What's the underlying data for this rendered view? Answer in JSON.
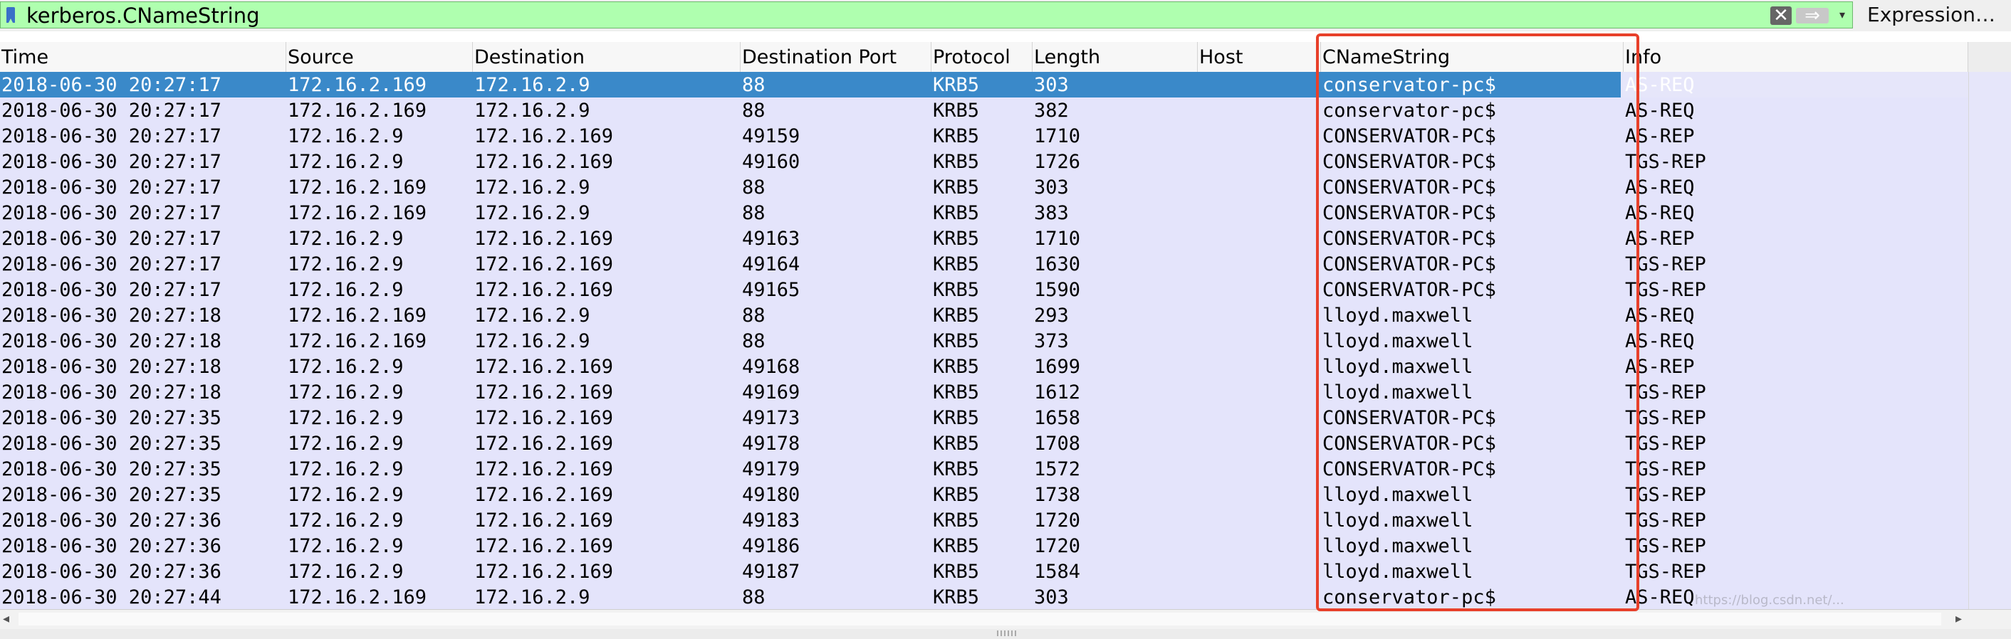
{
  "filter": {
    "value": "kerberos.CNameString",
    "expression_label": "Expression…",
    "clear_glyph": "✕",
    "apply_glyph": "⇒",
    "dropdown_glyph": "▾"
  },
  "columns": [
    "Time",
    "Source",
    "Destination",
    "Destination Port",
    "Protocol",
    "Length",
    "Host",
    "CNameString",
    "Info"
  ],
  "rows": [
    [
      "2018-06-30 20:27:17",
      "172.16.2.169",
      "172.16.2.9",
      "88",
      "KRB5",
      "303",
      "",
      "conservator-pc$",
      "AS-REQ"
    ],
    [
      "2018-06-30 20:27:17",
      "172.16.2.169",
      "172.16.2.9",
      "88",
      "KRB5",
      "382",
      "",
      "conservator-pc$",
      "AS-REQ"
    ],
    [
      "2018-06-30 20:27:17",
      "172.16.2.9",
      "172.16.2.169",
      "49159",
      "KRB5",
      "1710",
      "",
      "CONSERVATOR-PC$",
      "AS-REP"
    ],
    [
      "2018-06-30 20:27:17",
      "172.16.2.9",
      "172.16.2.169",
      "49160",
      "KRB5",
      "1726",
      "",
      "CONSERVATOR-PC$",
      "TGS-REP"
    ],
    [
      "2018-06-30 20:27:17",
      "172.16.2.169",
      "172.16.2.9",
      "88",
      "KRB5",
      "303",
      "",
      "CONSERVATOR-PC$",
      "AS-REQ"
    ],
    [
      "2018-06-30 20:27:17",
      "172.16.2.169",
      "172.16.2.9",
      "88",
      "KRB5",
      "383",
      "",
      "CONSERVATOR-PC$",
      "AS-REQ"
    ],
    [
      "2018-06-30 20:27:17",
      "172.16.2.9",
      "172.16.2.169",
      "49163",
      "KRB5",
      "1710",
      "",
      "CONSERVATOR-PC$",
      "AS-REP"
    ],
    [
      "2018-06-30 20:27:17",
      "172.16.2.9",
      "172.16.2.169",
      "49164",
      "KRB5",
      "1630",
      "",
      "CONSERVATOR-PC$",
      "TGS-REP"
    ],
    [
      "2018-06-30 20:27:17",
      "172.16.2.9",
      "172.16.2.169",
      "49165",
      "KRB5",
      "1590",
      "",
      "CONSERVATOR-PC$",
      "TGS-REP"
    ],
    [
      "2018-06-30 20:27:18",
      "172.16.2.169",
      "172.16.2.9",
      "88",
      "KRB5",
      "293",
      "",
      "lloyd.maxwell",
      "AS-REQ"
    ],
    [
      "2018-06-30 20:27:18",
      "172.16.2.169",
      "172.16.2.9",
      "88",
      "KRB5",
      "373",
      "",
      "lloyd.maxwell",
      "AS-REQ"
    ],
    [
      "2018-06-30 20:27:18",
      "172.16.2.9",
      "172.16.2.169",
      "49168",
      "KRB5",
      "1699",
      "",
      "lloyd.maxwell",
      "AS-REP"
    ],
    [
      "2018-06-30 20:27:18",
      "172.16.2.9",
      "172.16.2.169",
      "49169",
      "KRB5",
      "1612",
      "",
      "lloyd.maxwell",
      "TGS-REP"
    ],
    [
      "2018-06-30 20:27:35",
      "172.16.2.9",
      "172.16.2.169",
      "49173",
      "KRB5",
      "1658",
      "",
      "CONSERVATOR-PC$",
      "TGS-REP"
    ],
    [
      "2018-06-30 20:27:35",
      "172.16.2.9",
      "172.16.2.169",
      "49178",
      "KRB5",
      "1708",
      "",
      "CONSERVATOR-PC$",
      "TGS-REP"
    ],
    [
      "2018-06-30 20:27:35",
      "172.16.2.9",
      "172.16.2.169",
      "49179",
      "KRB5",
      "1572",
      "",
      "CONSERVATOR-PC$",
      "TGS-REP"
    ],
    [
      "2018-06-30 20:27:35",
      "172.16.2.9",
      "172.16.2.169",
      "49180",
      "KRB5",
      "1738",
      "",
      "lloyd.maxwell",
      "TGS-REP"
    ],
    [
      "2018-06-30 20:27:36",
      "172.16.2.9",
      "172.16.2.169",
      "49183",
      "KRB5",
      "1720",
      "",
      "lloyd.maxwell",
      "TGS-REP"
    ],
    [
      "2018-06-30 20:27:36",
      "172.16.2.9",
      "172.16.2.169",
      "49186",
      "KRB5",
      "1720",
      "",
      "lloyd.maxwell",
      "TGS-REP"
    ],
    [
      "2018-06-30 20:27:36",
      "172.16.2.9",
      "172.16.2.169",
      "49187",
      "KRB5",
      "1584",
      "",
      "lloyd.maxwell",
      "TGS-REP"
    ],
    [
      "2018-06-30 20:27:44",
      "172.16.2.169",
      "172.16.2.9",
      "88",
      "KRB5",
      "303",
      "",
      "conservator-pc$",
      "AS-REQ"
    ]
  ],
  "selected_row": 0,
  "highlighted_column": "CNameString",
  "watermark": "https://blog.csdn.net/...",
  "colors": {
    "filter_valid_bg": "#afffaf",
    "row_bg": "#e4e4fb",
    "selected_bg": "#3a89c9",
    "highlight_border": "#e8402a"
  }
}
